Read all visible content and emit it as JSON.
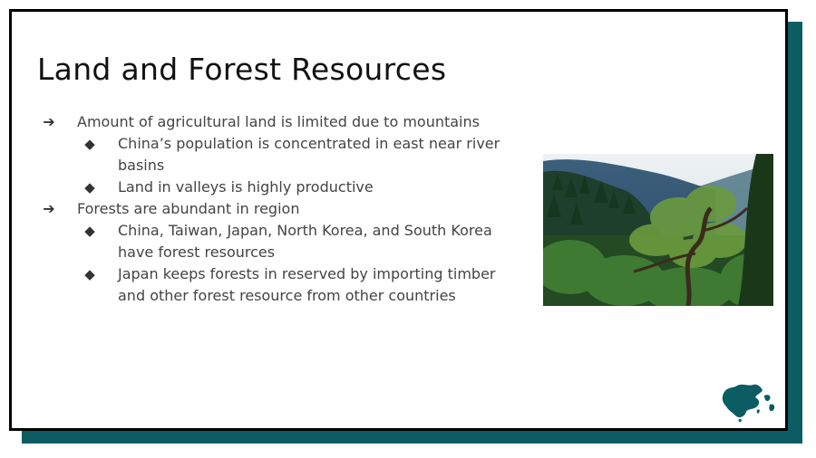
{
  "slide": {
    "title": "Land and Forest Resources",
    "bullets": [
      {
        "level": 1,
        "marker": "➔",
        "text": "Amount of agricultural land is limited due to mountains"
      },
      {
        "level": 2,
        "marker": "◆",
        "text": "China’s population is concentrated in east near river basins"
      },
      {
        "level": 2,
        "marker": "◆",
        "text": "Land in valleys is highly productive"
      },
      {
        "level": 1,
        "marker": "➔",
        "text": "Forests are abundant in region"
      },
      {
        "level": 2,
        "marker": "◆",
        "text": "China, Taiwan, Japan, North Korea, and South Korea have forest resources"
      },
      {
        "level": 2,
        "marker": "◆",
        "text": "Japan keeps forests in reserved by importing timber and other forest resource from other countries"
      }
    ],
    "image": {
      "icon": "forest-photo"
    },
    "logo": {
      "icon": "east-asia-map-icon",
      "color": "#0b5c63"
    }
  },
  "colors": {
    "accent": "#0b5c63",
    "border": "#000000",
    "title_text": "#111111",
    "body_text": "#444444"
  }
}
